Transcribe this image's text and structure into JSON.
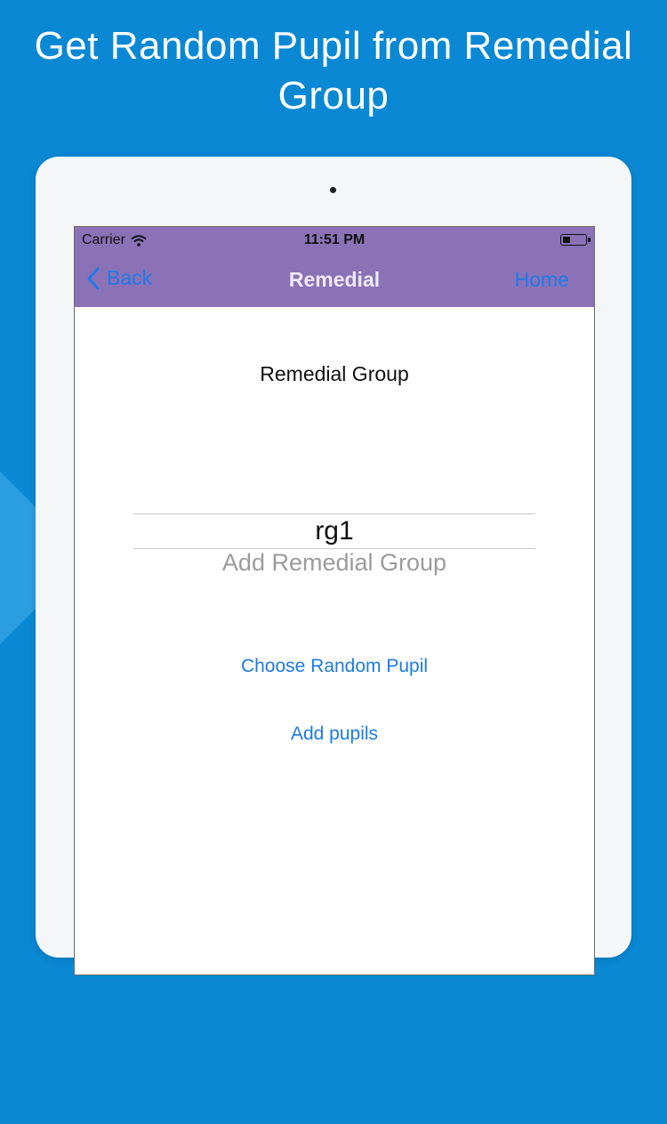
{
  "headline": "Get Random Pupil from Remedial Group",
  "status_bar": {
    "carrier": "Carrier",
    "time": "11:51 PM",
    "battery_level": 0.35
  },
  "navbar": {
    "back_label": "Back",
    "title": "Remedial",
    "home_label": "Home"
  },
  "content": {
    "group_label": "Remedial Group",
    "picker_selected": "rg1",
    "picker_next": "Add Remedial Group",
    "choose_random_label": "Choose Random Pupil",
    "add_pupils_label": "Add pupils"
  },
  "colors": {
    "background": "#0a88d4",
    "navbar": "#8b72b6",
    "accent": "#1d7ae8"
  },
  "icons": {
    "wifi": "wifi-icon",
    "battery": "battery-icon",
    "back": "chevron-left-icon"
  }
}
